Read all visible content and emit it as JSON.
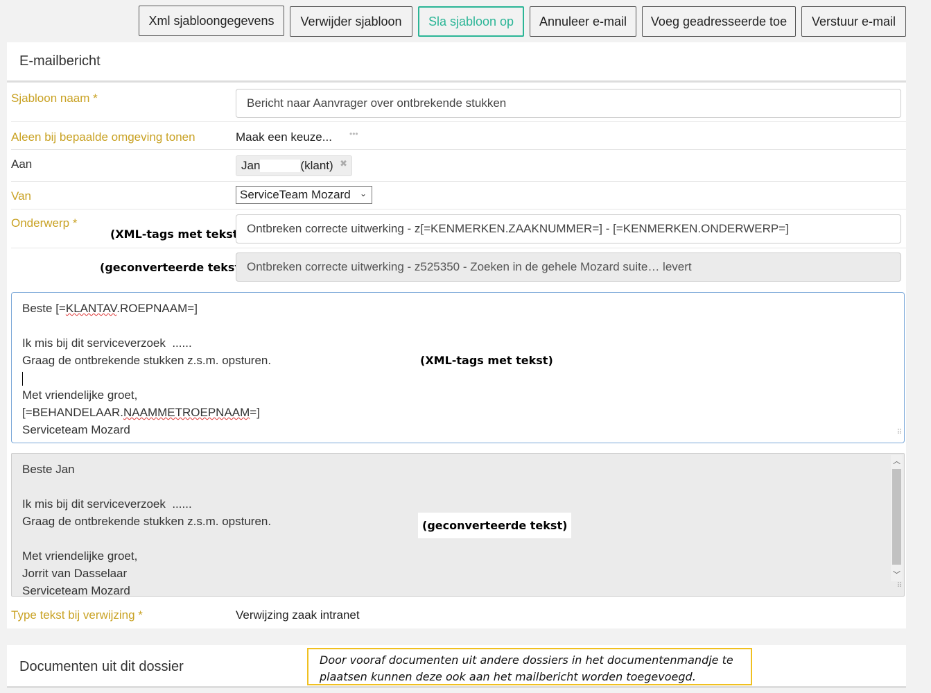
{
  "toolbar": {
    "buttons": [
      {
        "label": "Xml sjabloongegevens"
      },
      {
        "label": "Verwijder sjabloon"
      },
      {
        "label": "Sla sjabloon op"
      },
      {
        "label": "Annuleer e-mail"
      },
      {
        "label": "Voeg geadresseerde toe"
      },
      {
        "label": "Verstuur e-mail"
      }
    ]
  },
  "email_panel": {
    "title": "E-mailbericht",
    "template_name": {
      "label": "Sjabloon naam *",
      "value": "Bericht naar Aanvrager over ontbrekende stukken"
    },
    "environment": {
      "label": "Aleen bij bepaalde omgeving tonen",
      "value": "Maak een keuze..."
    },
    "to": {
      "label": "Aan",
      "first_name": "Jan",
      "suffix": "(klant)"
    },
    "from": {
      "label": "Van",
      "value": "ServiceTeam Mozard"
    },
    "subject": {
      "label": "Onderwerp *",
      "xml_annotation": "(XML-tags met tekst)",
      "xml_value": "Ontbreken correcte uitwerking - z[=KENMERKEN.ZAAKNUMMER=] -  [=KENMERKEN.ONDERWERP=]",
      "converted_annotation": "(geconverteerde tekst)",
      "converted_value": "Ontbreken correcte uitwerking - z525350 -  Zoeken in de gehele Mozard suite… levert"
    },
    "body_xml": {
      "annotation": "(XML-tags met tekst)",
      "line1_prefix": "Beste [=",
      "line1_spell": "KLANTAV",
      "line1_suffix": ".ROEPNAAM=]",
      "line3": "Ik mis bij dit serviceverzoek  ......",
      "line4": "Graag de ontbrekende stukken z.s.m. opsturen.",
      "line6": "Met vriendelijke groet,",
      "line7_prefix": "[=BEHANDELAAR.",
      "line7_spell": "NAAMMETROEPNAAM",
      "line7_suffix": "=]",
      "line8": "Serviceteam Mozard"
    },
    "body_converted": {
      "annotation": "(geconverteerde tekst)",
      "line1": "Beste Jan",
      "line3": "Ik mis bij dit serviceverzoek  ......",
      "line4": "Graag de ontbrekende stukken z.s.m. opsturen.",
      "line6": "Met vriendelijke groet,",
      "line7": "Jorrit van Dasselaar",
      "line8": "Serviceteam Mozard"
    },
    "reference_type": {
      "label": "Type tekst bij verwijzing *",
      "value": "Verwijzing zaak intranet"
    }
  },
  "documents_panel": {
    "title": "Documenten uit dit dossier",
    "note": "Door vooraf documenten uit andere dossiers in het documentenmandje te plaatsen kunnen deze ook aan het mailbericht worden toegevoegd."
  }
}
